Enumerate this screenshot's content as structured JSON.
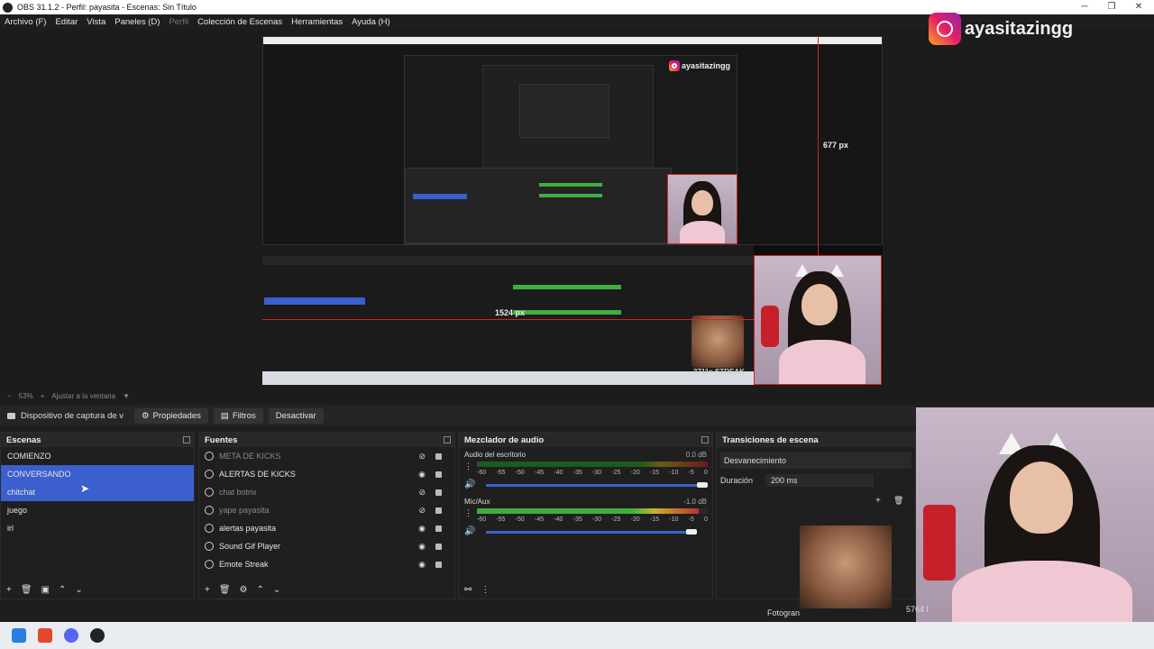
{
  "window": {
    "title": "OBS 31.1.2 - Perfil: payasita - Escenas: Sin Título"
  },
  "menu": {
    "items": [
      "Archivo (F)",
      "Editar",
      "Vista",
      "Paneles (D)",
      "Perfil",
      "Colección de Escenas",
      "Herramientas",
      "Ayuda (H)"
    ]
  },
  "overlay": {
    "instagram_handle": "ayasitazingg",
    "inner_handle": "ayasitazingg",
    "streak_label": "3711x STREAK",
    "measure_vertical": "677 px",
    "measure_horizontal": "1524 px"
  },
  "zoom": {
    "level": "53%",
    "fit_label": "Ajustar a la ventana"
  },
  "toolbar": {
    "source_name": "Dispositivo de captura de v",
    "properties": "Propiedades",
    "filters": "Filtros",
    "deactivate": "Desactivar"
  },
  "scenes": {
    "title": "Escenas",
    "items": [
      "COMIENZO",
      "CONVERSANDO",
      "chitchat",
      "juego",
      "irl"
    ],
    "selected": [
      "CONVERSANDO",
      "chitchat"
    ]
  },
  "sources": {
    "title": "Fuentes",
    "items": [
      {
        "name": "META DE KICKS",
        "visible": false
      },
      {
        "name": "ALERTAS DE KICKS",
        "visible": true
      },
      {
        "name": "chat botrix",
        "visible": false
      },
      {
        "name": "yape payasita",
        "visible": false
      },
      {
        "name": "alertas payasita",
        "visible": true
      },
      {
        "name": "Sound Gif Player",
        "visible": true
      },
      {
        "name": "Emote Streak",
        "visible": true
      }
    ]
  },
  "mixer": {
    "title": "Mezclador de audio",
    "channels": [
      {
        "name": "Audio del escritorio",
        "db": "0.0 dB",
        "level": 0.0,
        "volume": 1.0
      },
      {
        "name": "Mic/Aux",
        "db": "-1.0 dB",
        "level": 0.58,
        "volume": 0.94
      }
    ],
    "scale": [
      "-60",
      "-55",
      "-50",
      "-45",
      "-40",
      "-35",
      "-30",
      "-25",
      "-20",
      "-15",
      "-10",
      "-5",
      "0"
    ]
  },
  "transitions": {
    "title": "Transiciones de escena",
    "selected": "Desvanecimiento",
    "duration_label": "Duración",
    "duration_value": "200 ms",
    "frames_label": "Fotogran",
    "frames_value": "5764 l"
  },
  "colors": {
    "accent": "#3b5fcc",
    "guide_red": "#d42222"
  }
}
